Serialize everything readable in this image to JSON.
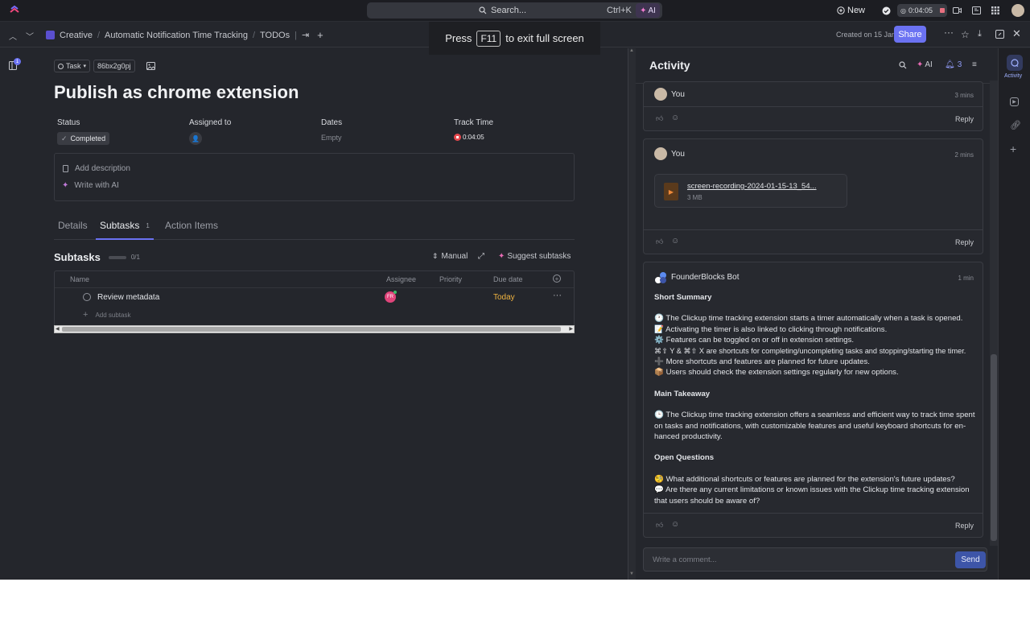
{
  "topbar": {
    "search_placeholder": "Search...",
    "search_shortcut": "Ctrl+K",
    "ai_label": "AI",
    "new_label": "New",
    "timer": "0:04:05"
  },
  "breadcrumb": {
    "items": [
      "Creative",
      "Automatic Notification Time Tracking",
      "TODOs"
    ],
    "created": "Created on 15 Jan",
    "share": "Share"
  },
  "fullscreen": {
    "prefix": "Press",
    "key": "F11",
    "suffix": "to exit full screen"
  },
  "leftrail": {
    "badge": "1"
  },
  "task": {
    "type_label": "Task",
    "id": "86bx2g0pj",
    "title": "Publish as chrome extension",
    "fields": {
      "status_label": "Status",
      "status_value": "Completed",
      "assigned_label": "Assigned to",
      "dates_label": "Dates",
      "dates_value": "Empty",
      "track_label": "Track Time",
      "track_value": "0:04:05"
    },
    "add_description": "Add description",
    "write_ai": "Write with AI",
    "tabs": [
      "Details",
      "Subtasks",
      "Action Items"
    ],
    "subtasks_count": "1"
  },
  "subtasks": {
    "heading": "Subtasks",
    "progress": "0/1",
    "progress_fraction": 0,
    "manual": "Manual",
    "suggest": "Suggest subtasks",
    "columns": [
      "Name",
      "Assignee",
      "Priority",
      "Due date"
    ],
    "rows": [
      {
        "name": "Review metadata",
        "assignee": "FR",
        "priority": "",
        "due": "Today"
      }
    ],
    "add": "Add subtask"
  },
  "activity": {
    "title": "Activity",
    "ai_label": "AI",
    "notif_count": "3",
    "comments": [
      {
        "user": "You",
        "time": "3 mins",
        "reply": "Reply"
      },
      {
        "user": "You",
        "time": "2 mins",
        "reply": "Reply",
        "file_name": "screen-recording-2024-01-15-13_54...",
        "file_size": "3 MB"
      },
      {
        "user": "FounderBlocks Bot",
        "time": "1 min",
        "reply": "Reply",
        "h1": "Short Summary",
        "lines1": [
          "🕐 The Clickup time tracking extension starts a timer automatically when a task is opened.",
          "📝 Activating the timer is also linked to clicking through notifications.",
          "⚙️ Features can be toggled on or off in extension settings.",
          "⌘⇧ Y & ⌘⇧ X are shortcuts for completing/uncompleting tasks and stopping/starting the timer.",
          "➕ More shortcuts and features are planned for future updates.",
          "📦 Users should check the extension settings regularly for new options."
        ],
        "h2": "Main Takeaway",
        "takeaway": "🕒 The Clickup time tracking extension offers a seamless and efficient way to track time spent on tasks and notifications, with customizable features and useful keyboard shortcuts for en-hanced productivity.",
        "h3": "Open Questions",
        "q1": "🧐 What additional shortcuts or features are planned for the extension's future updates?",
        "q2": "💬 Are there any current limitations or known issues with the Clickup time tracking extension that users should be aware of?"
      }
    ],
    "comment_placeholder": "Write a comment...",
    "send": "Send"
  },
  "rightrail": {
    "activity_label": "Activity"
  },
  "colors": {
    "accent": "#6b72f2",
    "status_green": "#3dbb6a",
    "timer_red": "#e5484d",
    "today": "#f0b440"
  }
}
